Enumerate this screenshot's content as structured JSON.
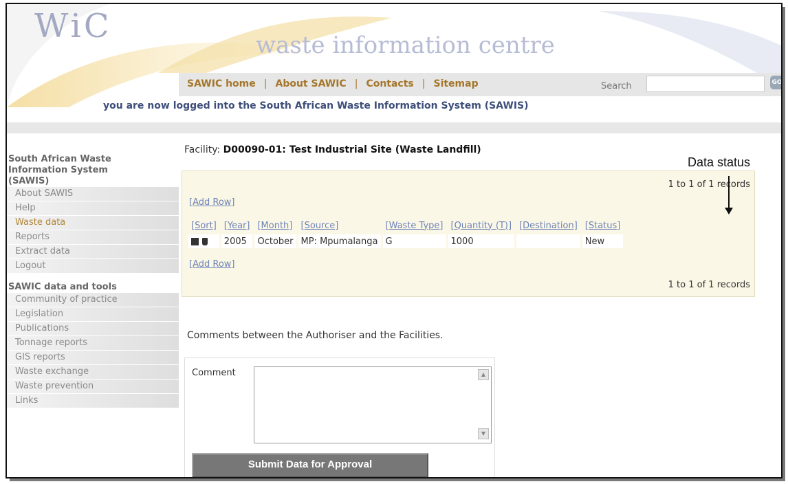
{
  "header": {
    "logo_text": "WiC",
    "site_title": "waste information centre",
    "nav": [
      "SAWIC home",
      "About SAWIC",
      "Contacts",
      "Sitemap"
    ],
    "nav_separator": "|",
    "search_label": "Search",
    "search_value": "",
    "go_label": "GO",
    "login_message": "you are now logged into the South African Waste Information System (SAWIS)"
  },
  "sidebar": {
    "section1_title_lines": [
      "South African Waste",
      "Information System",
      "(SAWIS)"
    ],
    "section1_items": [
      "About SAWIS",
      "Help",
      "Waste data",
      "Reports",
      "Extract data",
      "Logout"
    ],
    "section2_title": "SAWIC data and tools",
    "section2_items": [
      "Community of practice",
      "Legislation",
      "Publications",
      "Tonnage reports",
      "GIS reports",
      "Waste exchange",
      "Waste prevention",
      "Links"
    ]
  },
  "main": {
    "facility_label": "Facility:",
    "facility_name": "D00090-01: Test Industrial Site (Waste Landfill)",
    "pager_top": "1 to 1 of 1 records",
    "pager_bottom": "1 to 1 of 1 records",
    "add_row": "[Add Row]",
    "columns": [
      "[Sort]",
      "[Year]",
      "[Month]",
      "[Source]",
      "[Waste Type]",
      "[Quantity (T)]",
      "[Destination]",
      "[Status]"
    ],
    "rows": [
      {
        "year": "2005",
        "month": "October",
        "source": "MP: Mpumalanga",
        "waste_type": "G",
        "quantity": "1000",
        "destination": "",
        "status": "New"
      }
    ],
    "comments_intro": "Comments between the Authoriser and the Facilities.",
    "comment_label": "Comment",
    "comment_value": "",
    "submit_label": "Submit Data for Approval"
  },
  "annotation": {
    "label": "Data status"
  }
}
